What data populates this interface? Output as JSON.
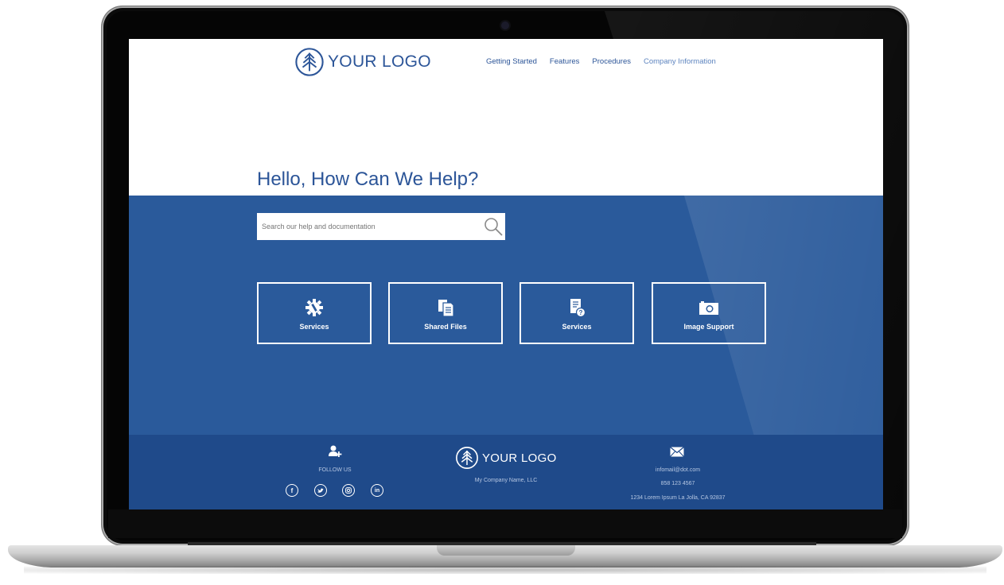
{
  "header": {
    "logo_text": "YOUR LOGO",
    "nav": [
      "Getting Started",
      "Features",
      "Procedures",
      "Company Information"
    ]
  },
  "hero": {
    "title": "Hello, How Can We Help?",
    "search_placeholder": "Search our help and documentation"
  },
  "cards": [
    {
      "label": "Services",
      "icon": "gear-wrench-icon"
    },
    {
      "label": "Shared Files",
      "icon": "documents-icon"
    },
    {
      "label": "Services",
      "icon": "document-question-icon"
    },
    {
      "label": "Image Support",
      "icon": "camera-icon"
    }
  ],
  "footer": {
    "follow_label": "FOLLOW US",
    "social": [
      "facebook-icon",
      "twitter-icon",
      "instagram-icon",
      "linkedin-icon"
    ],
    "logo_text": "YOUR LOGO",
    "company": "My Company Name, LLC",
    "email": "infomail@dot.com",
    "phone": "858 123 4567",
    "address": "1234 Lorem Ipsum La Jolla, CA 92837"
  },
  "colors": {
    "brand_blue": "#2c5598",
    "hero_blue": "#2a5a9b",
    "footer_blue": "#1f4a8a"
  }
}
